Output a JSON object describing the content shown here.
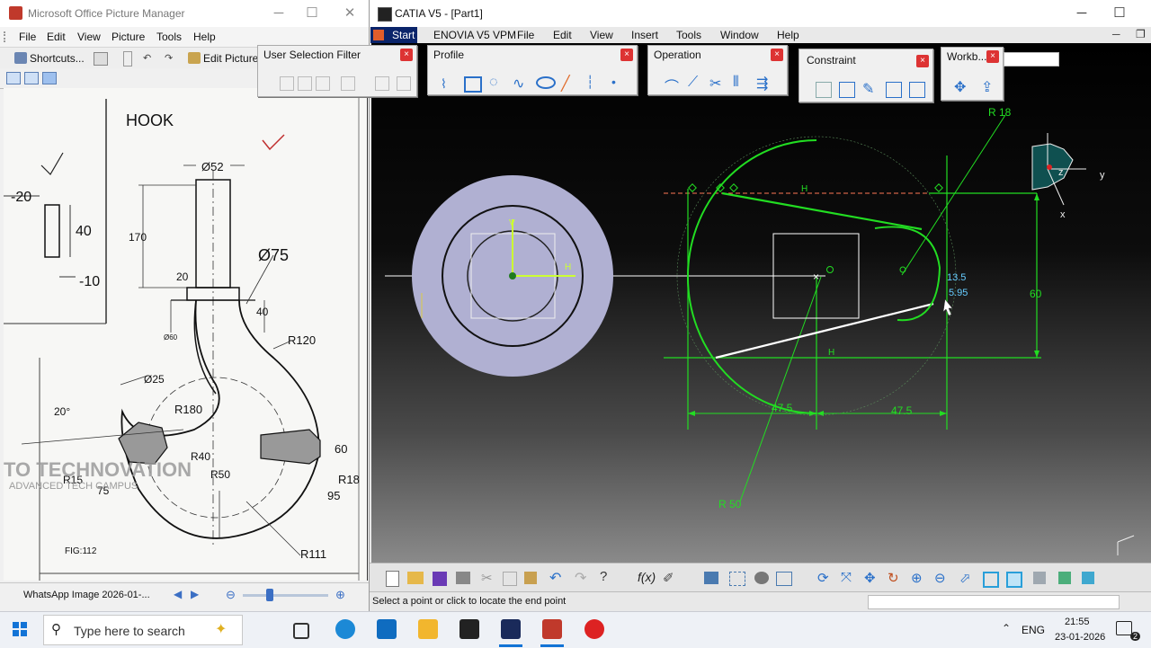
{
  "picture_manager": {
    "title": "Microsoft Office Picture Manager",
    "menu": [
      "File",
      "Edit",
      "View",
      "Picture",
      "Tools",
      "Help"
    ],
    "toolbar": {
      "shortcuts": "Shortcuts...",
      "edit_pictures": "Edit Pictures"
    },
    "drawing": {
      "title": "HOOK",
      "labels": [
        "Ø52",
        "170",
        "20",
        "Ø75",
        "40",
        "Ø60",
        "R120",
        "Ø25",
        "20°",
        "R180",
        "R40",
        "60",
        "R50",
        "R15",
        "75",
        "R18",
        "95",
        "R111",
        "FIG:112",
        "-20",
        "40",
        "-10"
      ],
      "watermark": "TO TECHNOVATION",
      "watermark_sub": "ADVANCED TECH CAMPUS"
    },
    "status": {
      "file": "WhatsApp Image 2026-01-..."
    }
  },
  "catia": {
    "title": "CATIA V5 - [Part1]",
    "menu": [
      "Start",
      "ENOVIA V5 VPM",
      "File",
      "Edit",
      "View",
      "Insert",
      "Tools",
      "Window",
      "Help"
    ],
    "palettes": {
      "user_selection_filter": "User Selection Filter",
      "profile": "Profile",
      "operation": "Operation",
      "constraint": "Constraint",
      "workbench": "Workb..."
    },
    "dimensions": [
      "R 18",
      "H",
      "H",
      "H",
      "60",
      "47.5",
      "47.5",
      "R 50",
      "13.5",
      "5.95"
    ],
    "axis_labels": {
      "y": "y",
      "x": "x",
      "z": "z",
      "V": "V",
      "H": "H"
    },
    "status": "Select a point or click to locate the end point"
  },
  "taskbar": {
    "search_placeholder": "Type here to search",
    "language": "ENG",
    "time": "21:55",
    "date": "23-01-2026",
    "notification_count": "2"
  },
  "colors": {
    "sketch_green": "#22dd22",
    "pad_fill": "#b0b0d2",
    "catia_menu_active": "#0a246a"
  }
}
